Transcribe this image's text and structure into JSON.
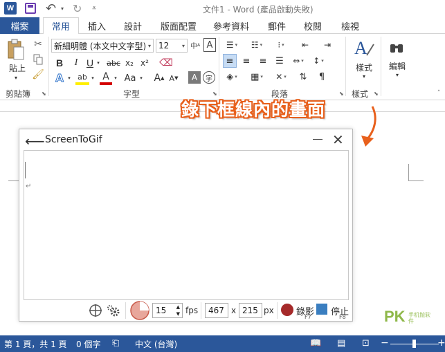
{
  "titlebar": {
    "logo_letter": "W",
    "title": "文件1 - Word (產品啟動失敗)"
  },
  "tabs": [
    {
      "label": "檔案"
    },
    {
      "label": "常用"
    },
    {
      "label": "插入"
    },
    {
      "label": "設計"
    },
    {
      "label": "版面配置"
    },
    {
      "label": "參考資料"
    },
    {
      "label": "郵件"
    },
    {
      "label": "校閱"
    },
    {
      "label": "檢視"
    }
  ],
  "ribbon": {
    "clipboard": {
      "paste_label": "貼上",
      "group_label": "剪貼簿"
    },
    "font": {
      "font_name": "新細明體 (本文中文字型)",
      "font_size": "12",
      "bold": "B",
      "italic": "I",
      "underline": "U",
      "strike": "abc",
      "subscript": "x₂",
      "superscript": "x²",
      "text_effect": "A",
      "highlight": "ab",
      "font_color": "A",
      "change_case": "Aa",
      "grow": "A",
      "shrink": "A",
      "group_label": "字型"
    },
    "paragraph": {
      "group_label": "段落"
    },
    "styles": {
      "label": "樣式",
      "group_label": "樣式"
    },
    "editing": {
      "label": "編輯"
    }
  },
  "annotation": {
    "text": "錄下框線內的畫面",
    "color": "#e8601c"
  },
  "screentogif": {
    "title": "ScreenToGif",
    "fps_value": "15",
    "fps_label": "fps",
    "width_value": "467",
    "times": "x",
    "height_value": "215",
    "px_label": "px",
    "record_label": "錄影",
    "record_key": "F7",
    "stop_label": "停止",
    "stop_key": "F8",
    "record_color": "#a52a2a",
    "stop_color": "#3a7ec0"
  },
  "statusbar": {
    "page": "第 1 頁，共 1 頁",
    "words": "0 個字",
    "language": "中文 (台灣)",
    "color": "#2b579a"
  },
  "watermark": {
    "main": "PK",
    "sub": "手机抛软件"
  }
}
